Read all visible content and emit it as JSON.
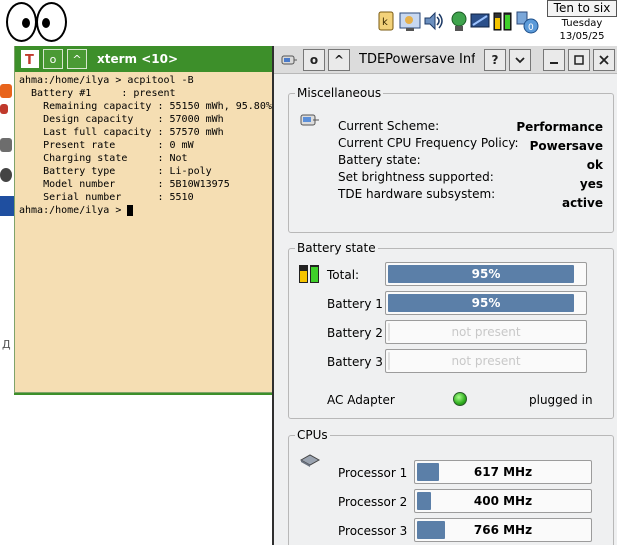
{
  "clock": {
    "time": "Ten to six",
    "day": "Tuesday",
    "date": "13/05/25"
  },
  "tray": {
    "network_badge": "0"
  },
  "xterm": {
    "title": "xterm <10>",
    "lines": [
      "ahma:/home/ilya > acpitool -B",
      "  Battery #1     : present",
      "    Remaining capacity : 55150 mWh, 95.80%",
      "    Design capacity    : 57000 mWh",
      "    Last full capacity : 57570 mWh",
      "    Present rate       : 0 mW",
      "    Charging state     : Not",
      "    Battery type       : Li-poly",
      "    Model number       : 5B10W13975",
      "    Serial number      : 5510"
    ],
    "prompt": "ahma:/home/ilya > "
  },
  "powersave": {
    "title": "TDEPowersave Infor",
    "misc": {
      "heading": "Miscellaneous",
      "rows": [
        {
          "label": "Current Scheme:",
          "value": "Performance"
        },
        {
          "label": "Current CPU Frequency Policy:",
          "value": "Powersave"
        },
        {
          "label": "Battery state:",
          "value": "ok"
        },
        {
          "label": "Set brightness supported:",
          "value": "yes"
        },
        {
          "label": "TDE hardware subsystem:",
          "value": "active"
        }
      ]
    },
    "battery": {
      "heading": "Battery state",
      "total": {
        "label": "Total:",
        "text": "95%",
        "level": 0.95
      },
      "batteries": [
        {
          "label": "Battery 1",
          "text": "95%",
          "level": 0.95,
          "enabled": true
        },
        {
          "label": "Battery 2",
          "text": "not present",
          "level": 0,
          "enabled": false
        },
        {
          "label": "Battery 3",
          "text": "not present",
          "level": 0,
          "enabled": false
        }
      ],
      "ac": {
        "label": "AC Adapter",
        "status": "plugged in"
      }
    },
    "cpus": {
      "heading": "CPUs",
      "processors": [
        {
          "label": "Processor 1",
          "text": "617 MHz",
          "level": 0.13
        },
        {
          "label": "Processor 2",
          "text": "400 MHz",
          "level": 0.08
        },
        {
          "label": "Processor 3",
          "text": "766 MHz",
          "level": 0.16
        }
      ]
    }
  }
}
